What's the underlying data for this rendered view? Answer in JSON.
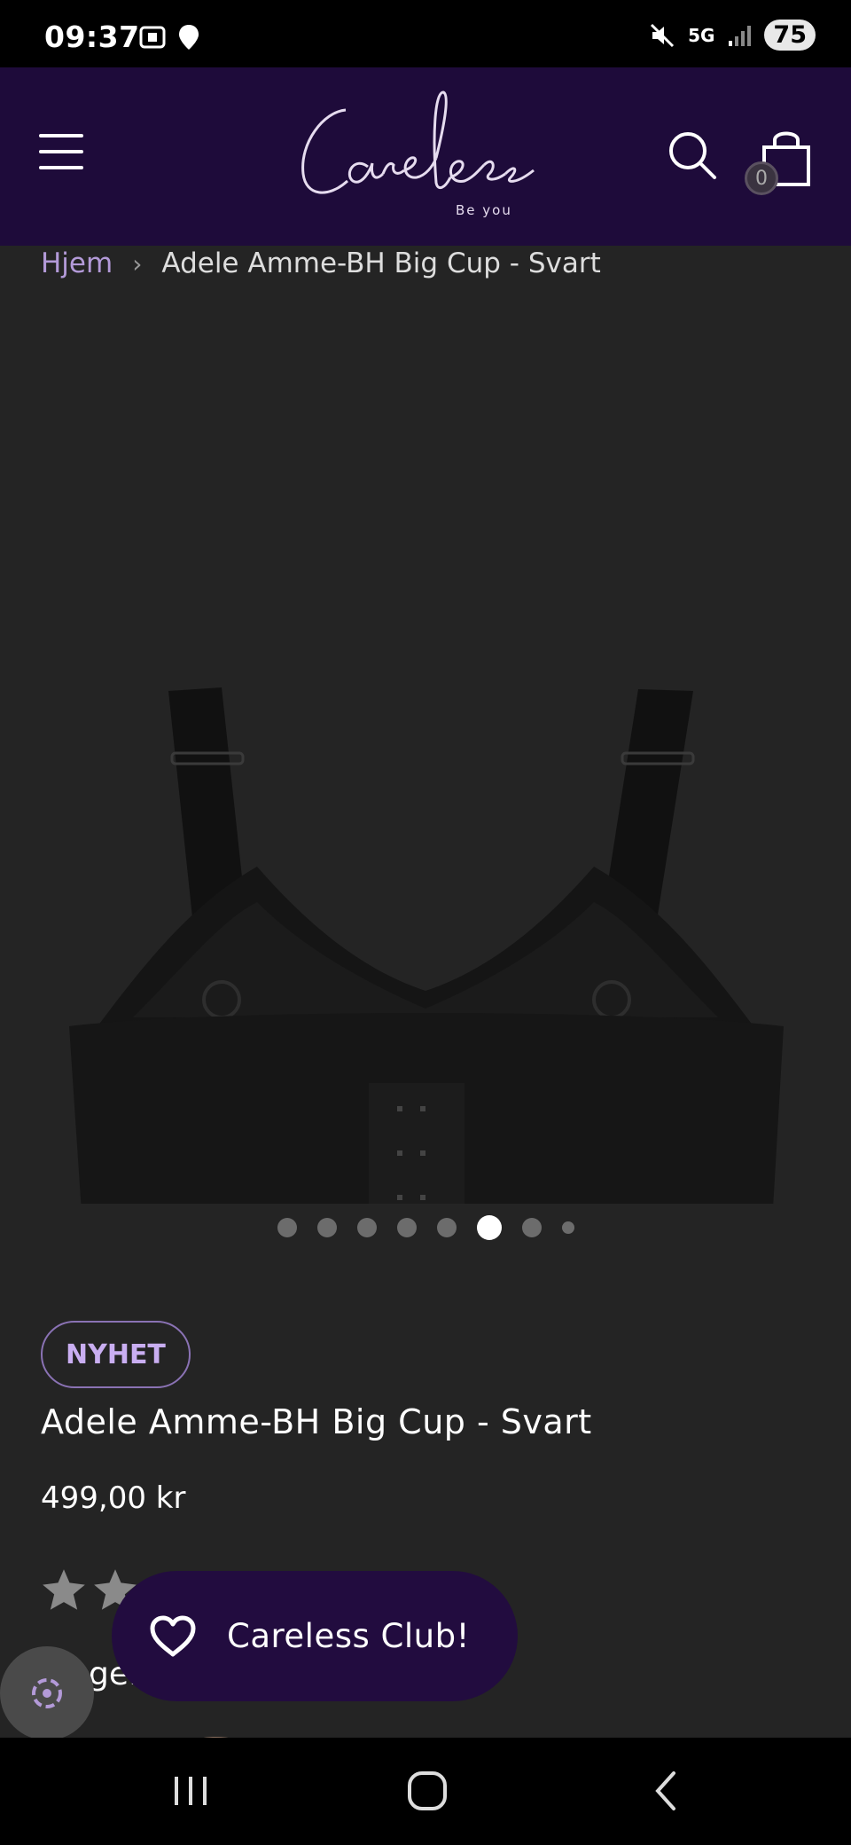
{
  "status_bar": {
    "time": "09:37",
    "battery": "75",
    "network": "5G"
  },
  "header": {
    "logo_text": "Careless",
    "logo_tagline": "Be you",
    "cart_count": "0",
    "background_color": "#1e0b3a"
  },
  "breadcrumb": {
    "home": "Hjem",
    "separator": "›",
    "current": "Adele Amme-BH Big Cup - Svart"
  },
  "gallery": {
    "total_dots": 8,
    "active_index": 5
  },
  "product": {
    "badge": "NYHET",
    "title": "Adele Amme-BH Big Cup - Svart",
    "price": "499,00 kr",
    "partial_text": "ge."
  },
  "club_button": {
    "label": "Careless Club!"
  },
  "icons": {
    "menu": "hamburger-icon",
    "search": "search-icon",
    "cart": "shopping-bag-icon",
    "heart": "heart-icon",
    "accessibility": "accessibility-icon",
    "star": "star-icon"
  },
  "colors": {
    "accent": "#b39ad8",
    "badge_text": "#c9aef1",
    "page_background": "#242424"
  }
}
